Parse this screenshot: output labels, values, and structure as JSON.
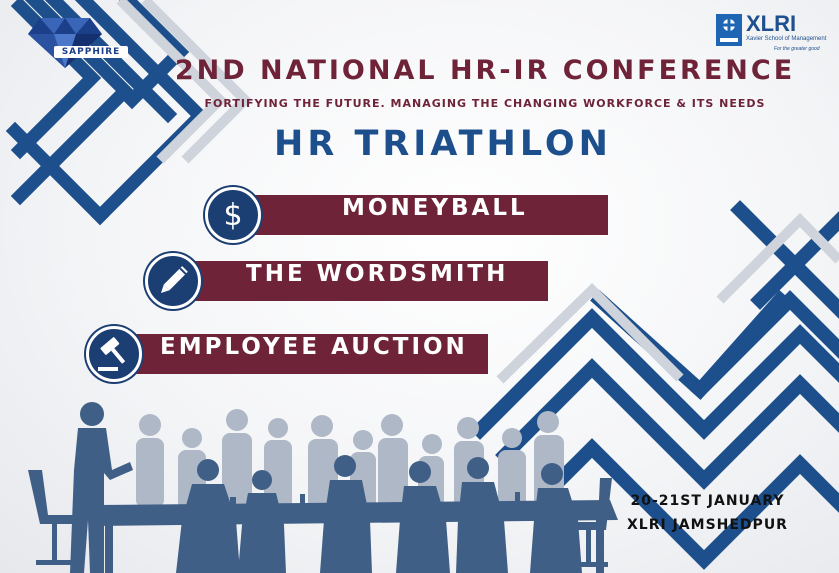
{
  "logos": {
    "left": {
      "name": "SAPPHIRE",
      "icon": "diamond-icon"
    },
    "right": {
      "name": "XLRI",
      "subtitle": "Xavier School of Management",
      "tagline": "For the greater good",
      "icon": "xlri-emblem-icon"
    }
  },
  "header": {
    "title": "2ND NATIONAL HR-IR CONFERENCE",
    "subtitle": "FORTIFYING THE FUTURE. MANAGING THE CHANGING WORKFORCE & ITS NEEDS"
  },
  "event": {
    "title": "HR TRIATHLON"
  },
  "events": [
    {
      "label": "MONEYBALL",
      "icon": "dollar-icon"
    },
    {
      "label": "THE WORDSMITH",
      "icon": "pencil-icon"
    },
    {
      "label": "EMPLOYEE AUCTION",
      "icon": "gavel-icon"
    }
  ],
  "footer": {
    "date": "20-21ST JANUARY",
    "venue": "XLRI JAMSHEDPUR"
  },
  "colors": {
    "maroon": "#6e2338",
    "navy": "#1c3f8a",
    "title_blue": "#1c4f8c",
    "silhouette_dark": "#3f5f86",
    "silhouette_light": "#aeb8c6"
  }
}
